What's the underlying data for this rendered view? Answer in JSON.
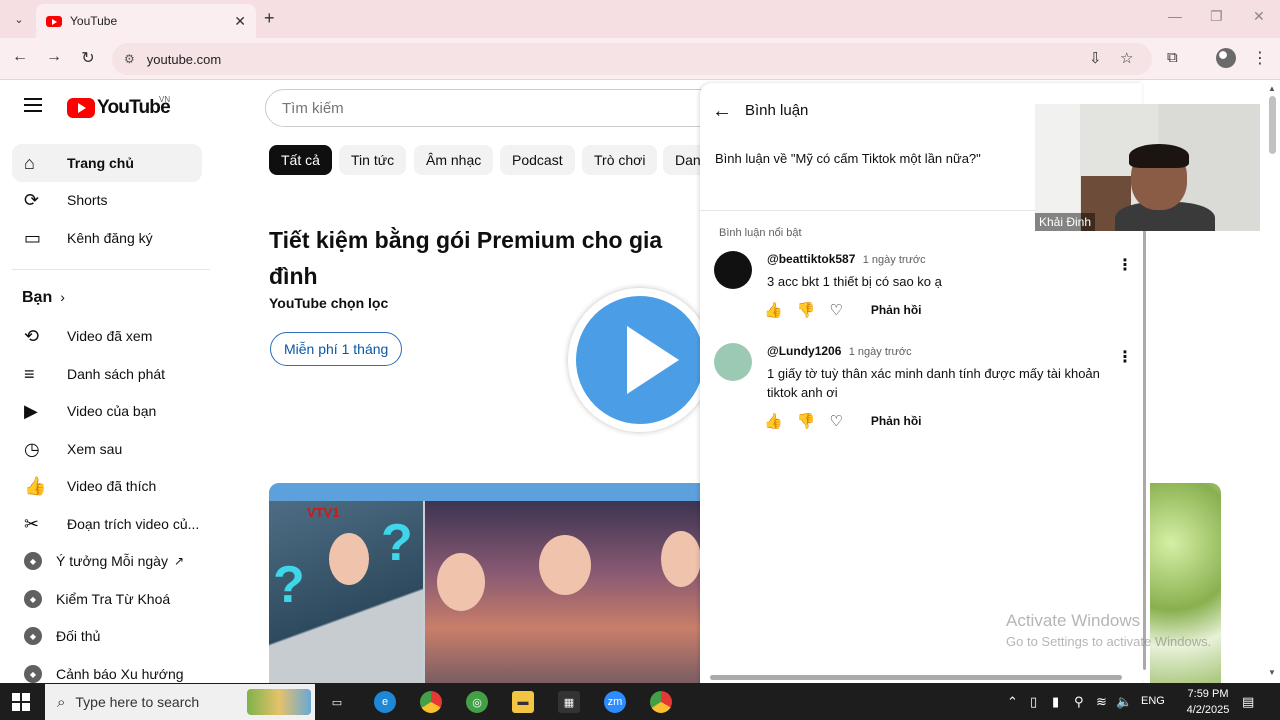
{
  "browser": {
    "tab_title": "YouTube",
    "url": "youtube.com",
    "tab_close": "✕",
    "new_tab": "+"
  },
  "youtube": {
    "logo_text": "YouTube",
    "country_code": "VN",
    "search_placeholder": "Tìm kiếm"
  },
  "sidebar": {
    "items": [
      {
        "label": "Trang chủ",
        "icon": "home-icon"
      },
      {
        "label": "Shorts",
        "icon": "shorts-icon"
      },
      {
        "label": "Kênh đăng ký",
        "icon": "subscriptions-icon"
      }
    ],
    "section_title": "Bạn",
    "you_items": [
      {
        "label": "Video đã xem",
        "icon": "history-icon"
      },
      {
        "label": "Danh sách phát",
        "icon": "playlist-icon"
      },
      {
        "label": "Video của bạn",
        "icon": "your-videos-icon"
      },
      {
        "label": "Xem sau",
        "icon": "watch-later-icon"
      },
      {
        "label": "Video đã thích",
        "icon": "liked-icon"
      },
      {
        "label": "Đoạn trích video củ...",
        "icon": "clips-icon"
      }
    ],
    "channels": [
      {
        "label": "Ý tưởng Mỗi ngày",
        "external": "↗"
      },
      {
        "label": "Kiểm Tra Từ Khoá"
      },
      {
        "label": "Đối thủ"
      },
      {
        "label": "Cảnh báo Xu hướng"
      }
    ]
  },
  "chips": [
    "Tất cả",
    "Tin tức",
    "Âm nhạc",
    "Podcast",
    "Trò chơi",
    "Danh"
  ],
  "promo": {
    "title": "Tiết kiệm bằng gói Premium cho gia đình",
    "subtitle": "YouTube chọn lọc",
    "button": "Miễn phí 1 tháng"
  },
  "thumbnail": {
    "logo_text": "VTV1"
  },
  "comments_panel": {
    "title": "Bình luận",
    "about": "Bình luận về \"Mỹ có cấm Tiktok một lần nữa?\"",
    "featured_label": "Bình luận nổi bật",
    "reply_label": "Phản hồi",
    "comments": [
      {
        "user": "@beattiktok587",
        "time": "1 ngày trước",
        "text": "3 acc bkt 1 thiết bị có sao ko ạ",
        "avatar_color": "#111111"
      },
      {
        "user": "@Lundy1206",
        "time": "1 ngày trước",
        "text": "1 giấy tờ tuỳ thân xác minh danh tính được mấy tài khoản tiktok anh ơi",
        "avatar_color": "#9cc9b4"
      }
    ]
  },
  "webcam": {
    "name": "Khải Đinh"
  },
  "watermark": {
    "line1": "Activate Windows",
    "line2": "Go to Settings to activate Windows."
  },
  "taskbar": {
    "search_placeholder": "Type here to search",
    "language": "ENG",
    "time": "7:59 PM",
    "date": "4/2/2025"
  }
}
